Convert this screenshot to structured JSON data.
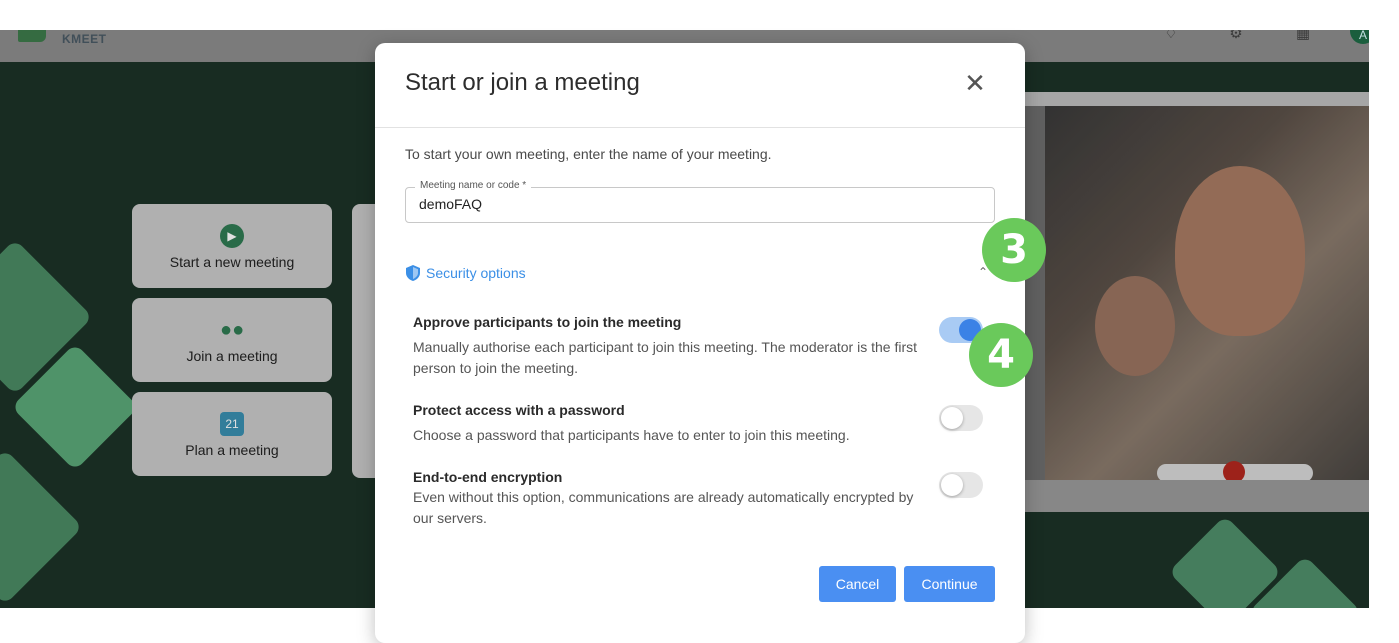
{
  "header": {
    "app_name": "KMEET",
    "avatar_initial": "A"
  },
  "home": {
    "cards": [
      {
        "label": "Start a new meeting",
        "icon": "video-camera-icon"
      },
      {
        "label": "Join a meeting",
        "icon": "people-icon"
      },
      {
        "label": "Plan a meeting",
        "icon": "calendar-icon",
        "icon_text": "21"
      }
    ]
  },
  "modal": {
    "title": "Start or join a meeting",
    "close_glyph": "✕",
    "intro": "To start your own meeting, enter the name of your meeting.",
    "field": {
      "label": "Meeting name or code *",
      "value": "demoFAQ"
    },
    "security_label": "Security options",
    "options": [
      {
        "title": "Approve participants to join the meeting",
        "description": "Manually authorise each participant to join this meeting. The moderator is the first person to join the meeting.",
        "enabled": true
      },
      {
        "title": "Protect access with a password",
        "description": "Choose a password that participants have to enter to join this meeting.",
        "enabled": false
      },
      {
        "title": "End-to-end encryption",
        "description": "Even without this option, communications are already automatically encrypted by our servers.",
        "enabled": false
      }
    ],
    "cancel_label": "Cancel",
    "continue_label": "Continue"
  },
  "annotations": {
    "step3": "3",
    "step4": "4"
  },
  "colors": {
    "accent": "#4a8ff2",
    "link": "#3b8fe6",
    "badge": "#6ac95b",
    "background": "#1c3327"
  }
}
